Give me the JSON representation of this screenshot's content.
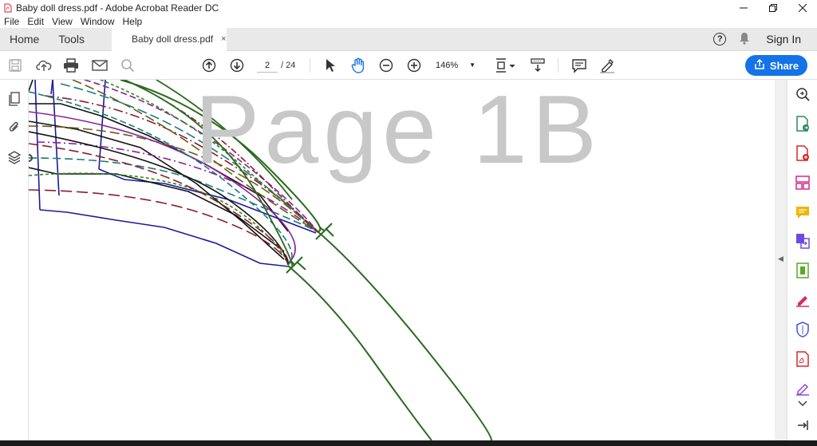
{
  "window": {
    "title": "Baby doll dress.pdf - Adobe Acrobat Reader DC"
  },
  "menu": [
    "File",
    "Edit",
    "View",
    "Window",
    "Help"
  ],
  "tabs": {
    "home": "Home",
    "tools": "Tools",
    "document": "Baby doll dress.pdf",
    "close": "×"
  },
  "account": {
    "help": "?",
    "sign_in": "Sign In"
  },
  "toolbar": {
    "current_page": "2",
    "total_pages": "/ 24",
    "zoom": "146%",
    "share_label": "Share"
  },
  "document": {
    "watermark": "Page 1B"
  },
  "colors": {
    "accent": "#1473e6",
    "pattern_green": "#2a6a1f",
    "pattern_navy": "#1a1aa0",
    "pattern_black": "#111111",
    "pattern_maroon": "#8a1f2a",
    "pattern_purple": "#8a1f9a",
    "pattern_teal": "#1a7a7a",
    "pattern_olive": "#6a5a1a",
    "pattern_lime": "#2a8a1a"
  },
  "icons": {
    "left_panel": [
      "pages-icon",
      "attachment-icon",
      "layers-icon"
    ],
    "right_panel": [
      "search-enhance-icon",
      "export-pdf-icon",
      "create-pdf-icon",
      "organize-pages-icon",
      "comment-icon",
      "combine-files-icon",
      "compress-pdf-icon",
      "fill-sign-icon",
      "protect-icon",
      "pdf-icon",
      "edit-pdf-icon",
      "more-tools-chevron-icon",
      "collapse-panel-icon"
    ]
  }
}
